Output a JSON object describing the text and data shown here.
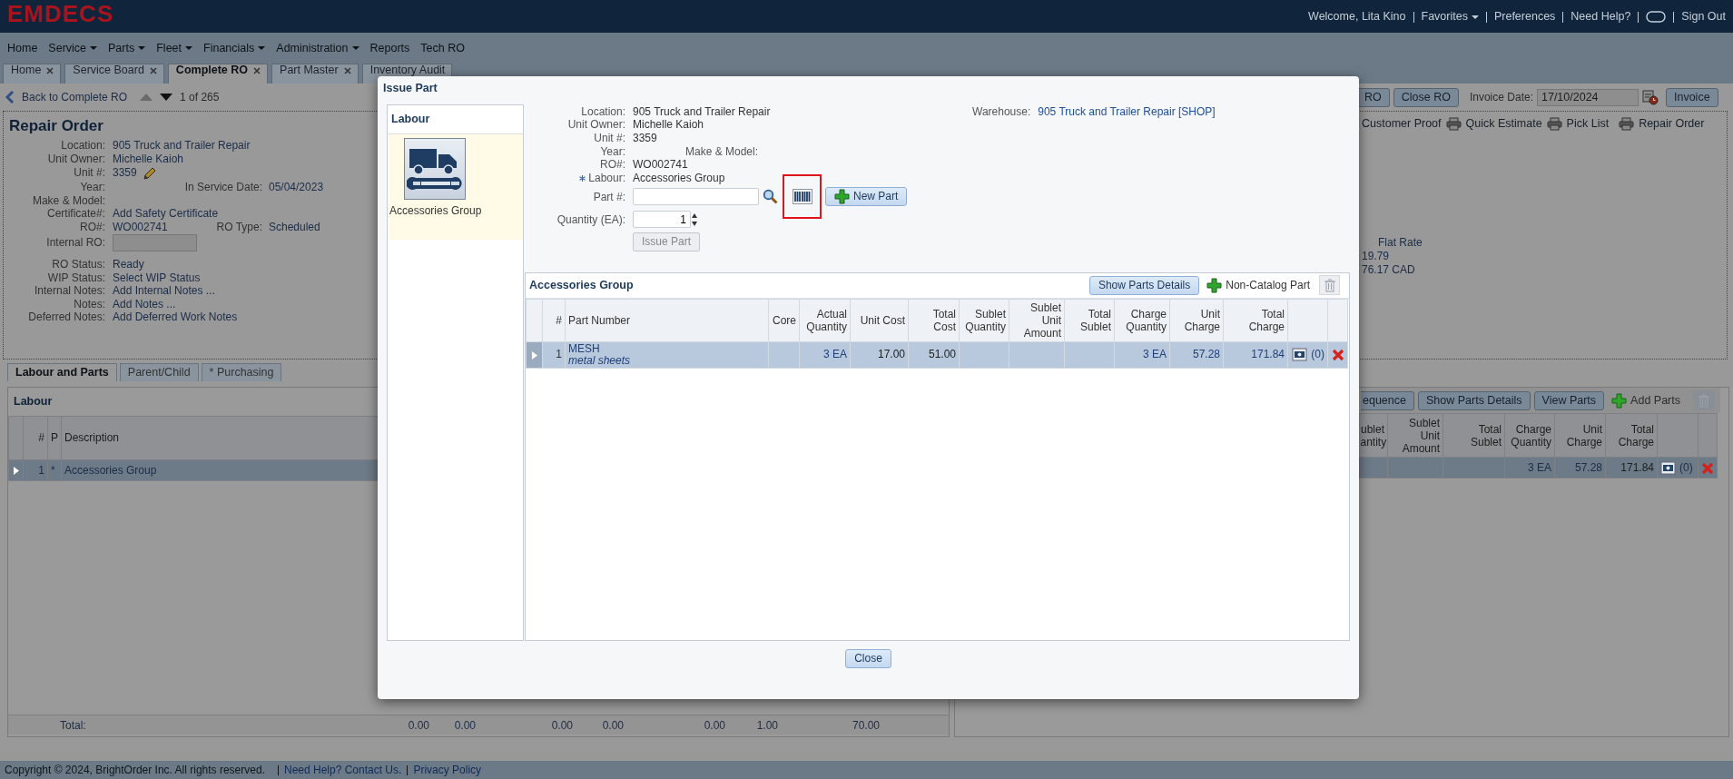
{
  "header": {
    "logo": "EMDECS",
    "welcome": "Welcome, Lita Kino",
    "links": [
      {
        "kind": "link",
        "label": "Favorites",
        "dropdown": true
      },
      {
        "kind": "link",
        "label": "Preferences",
        "dropdown": false
      },
      {
        "kind": "link",
        "label": "Need Help?",
        "dropdown": false
      },
      {
        "kind": "chat"
      },
      {
        "kind": "link",
        "label": "Sign Out",
        "dropdown": false
      }
    ]
  },
  "menu": [
    {
      "label": "Home",
      "dropdown": false
    },
    {
      "label": "Service",
      "dropdown": true
    },
    {
      "label": "Parts",
      "dropdown": true
    },
    {
      "label": "Fleet",
      "dropdown": true
    },
    {
      "label": "Financials",
      "dropdown": true
    },
    {
      "label": "Administration",
      "dropdown": true
    },
    {
      "label": "Reports",
      "dropdown": false
    },
    {
      "label": "Tech RO",
      "dropdown": false
    }
  ],
  "tabs": [
    {
      "label": "Home",
      "selected": false,
      "closable": true
    },
    {
      "label": "Service Board",
      "selected": false,
      "closable": true
    },
    {
      "label": "Complete RO",
      "selected": true,
      "closable": true
    },
    {
      "label": "Part Master",
      "selected": false,
      "closable": true
    },
    {
      "label": "Inventory Audit",
      "selected": false,
      "closable": false
    }
  ],
  "toolbar": {
    "back": "Back to Complete RO",
    "pager": "1 of 265",
    "buttons": [
      "RO",
      "Close RO"
    ],
    "invoice_date": {
      "label": "Invoice Date:",
      "value": "17/10/2024"
    },
    "invoice_button": "Invoice"
  },
  "print_links": [
    "Customer Proof",
    "Quick Estimate",
    "Pick List",
    "Repair Order"
  ],
  "repair_order": {
    "title": "Repair Order",
    "fields": [
      {
        "kind": "text",
        "label": "Location:",
        "value": "905 Truck and Trailer Repair"
      },
      {
        "kind": "text",
        "label": "Unit Owner:",
        "value": "Michelle Kaioh"
      },
      {
        "kind": "edit",
        "label": "Unit #:",
        "value": "3359"
      },
      {
        "kind": "text",
        "label": "Year:",
        "side_label": "In Service Date:",
        "side_value": "05/04/2023"
      },
      {
        "kind": "text",
        "label": "Make & Model:"
      },
      {
        "kind": "text",
        "label": "Certificate#:",
        "value": "Add Safety Certificate"
      },
      {
        "kind": "text",
        "label": "RO#:",
        "value": "WO002741",
        "side_label": "RO Type:",
        "side_value": "Scheduled"
      },
      {
        "kind": "input",
        "label": "Internal RO:"
      },
      {
        "kind": "text",
        "label": "RO Status:",
        "value": "Ready"
      },
      {
        "kind": "text",
        "label": "WIP Status:",
        "value": "Select WIP Status"
      },
      {
        "kind": "text",
        "label": "Internal Notes:",
        "value": "Add Internal Notes ..."
      },
      {
        "kind": "text",
        "label": "Notes:",
        "value": "Add Notes ..."
      },
      {
        "kind": "text",
        "label": "Deferred Notes:",
        "value": "Add Deferred Work Notes"
      }
    ]
  },
  "rates": {
    "heading": "Flat Rate",
    "values": [
      "19.79",
      "76.17 CAD"
    ]
  },
  "section_tabs": [
    {
      "label": "Labour and Parts",
      "selected": true
    },
    {
      "label": "Parent/Child",
      "selected": false
    },
    {
      "label": "* Purchasing",
      "selected": false
    }
  ],
  "labour_panel": {
    "title": "Labour",
    "columns": [
      "#",
      "P",
      "Description"
    ],
    "rows": [
      {
        "number": "1",
        "p": "*",
        "description": "Accessories Group",
        "selected": true
      }
    ],
    "totals": {
      "label": "Total:",
      "values": [
        "0.00",
        "0.00",
        "0.00",
        "0.00",
        "0.00",
        "1.00",
        "70.00"
      ]
    }
  },
  "parts_panel": {
    "buttons": [
      "equence",
      "Show Parts Details",
      "View Parts"
    ],
    "add": "Add Parts",
    "columns": [
      "ublet antity",
      "Sublet Unit Amount",
      "Total Sublet",
      "Charge Quantity",
      "Unit Charge",
      "Total Charge"
    ],
    "rows": [
      {
        "charge_quantity": "3 EA",
        "unit_charge": "57.28",
        "total_charge": "171.84",
        "attachments": "(0)",
        "selected": true
      }
    ]
  },
  "issue_part": {
    "title": "Issue Part",
    "labour": {
      "title": "Labour",
      "items": [
        {
          "label": "Accessories Group",
          "selected": true
        }
      ]
    },
    "fields": [
      {
        "label": "Location:",
        "value": "905 Truck and Trailer Repair",
        "required": false
      },
      {
        "label": "Unit Owner:",
        "value": "Michelle Kaioh",
        "required": false
      },
      {
        "label": "Unit #:",
        "value": "3359",
        "required": false
      },
      {
        "label": "Year:",
        "side_label": "Make & Model:",
        "required": false
      },
      {
        "label": "RO#:",
        "value": "WO002741",
        "required": false
      },
      {
        "label": "Labour:",
        "value": "Accessories Group",
        "required": true
      }
    ],
    "part_field": {
      "label": "Part #:",
      "barcode_highlighted": true,
      "new_part": "New Part"
    },
    "quantity": {
      "label": "Quantity (EA):",
      "value": "1"
    },
    "issue_button": {
      "label": "Issue Part",
      "disabled": true
    },
    "warehouse": {
      "label": "Warehouse:",
      "value": "905 Truck and Trailer Repair [SHOP]"
    },
    "table": {
      "title": "Accessories Group",
      "details_button": "Show Parts Details",
      "add": "Non-Catalog Part",
      "columns": [
        "#",
        "Part Number",
        "Core",
        "Actual Quantity",
        "Unit Cost",
        "Total Cost",
        "Sublet Quantity",
        "Sublet Unit Amount",
        "Total Sublet",
        "Charge Quantity",
        "Unit Charge",
        "Total Charge"
      ],
      "rows": [
        {
          "number": "1",
          "part_number": "MESH",
          "description": "metal sheets",
          "actual_quantity": "3 EA",
          "unit_cost": "17.00",
          "total_cost": "51.00",
          "charge_quantity": "3 EA",
          "unit_charge": "57.28",
          "total_charge": "171.84",
          "attachments": "(0)",
          "selected": true
        }
      ]
    },
    "close": "Close"
  },
  "footer": {
    "copyright": "Copyright © 2024, BrightOrder Inc. All rights reserved.",
    "links": [
      "Need Help? Contact Us.",
      "Privacy Policy"
    ]
  }
}
